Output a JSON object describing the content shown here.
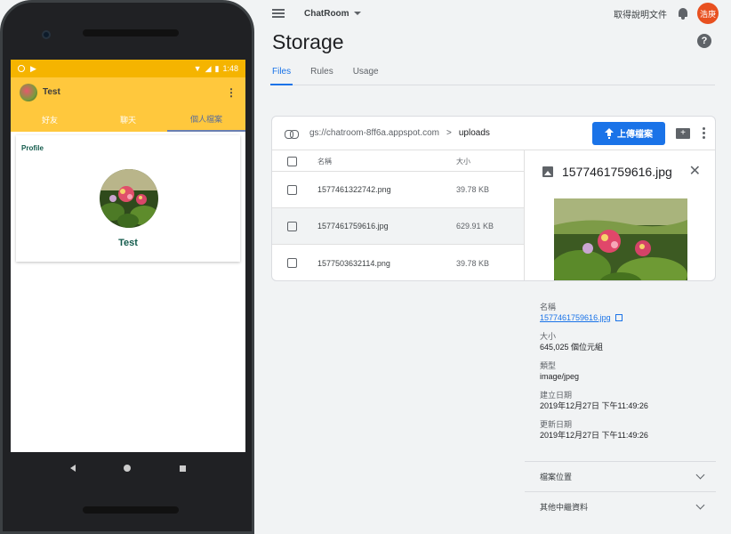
{
  "phone": {
    "status": {
      "time": "1:48"
    },
    "app_bar": {
      "title": "Test"
    },
    "tabs": [
      "好友",
      "聊天",
      "個人檔案"
    ],
    "profile": {
      "section_label": "Profile",
      "name": "Test"
    }
  },
  "console": {
    "project": "ChatRoom",
    "doc_link": "取得說明文件",
    "user_badge": "浩庚",
    "page_title": "Storage",
    "help": "?",
    "tabs": [
      "Files",
      "Rules",
      "Usage"
    ],
    "bucket": "gs://chatroom-8ff6a.appspot.com",
    "crumb_sep": ">",
    "crumb": "uploads",
    "upload_label": "上傳檔案",
    "table": {
      "col_name": "名稱",
      "col_size": "大小",
      "rows": [
        {
          "name": "1577461322742.png",
          "size": "39.78 KB"
        },
        {
          "name": "1577461759616.jpg",
          "size": "629.91 KB"
        },
        {
          "name": "1577503632114.png",
          "size": "39.78 KB"
        }
      ]
    },
    "detail": {
      "title": "1577461759616.jpg",
      "close": "✕",
      "name_label": "名稱",
      "name_value": "1577461759616.jpg",
      "size_label": "大小",
      "size_value": "645,025 個位元組",
      "type_label": "類型",
      "type_value": "image/jpeg",
      "created_label": "建立日期",
      "created_value": "2019年12月27日 下午11:49:26",
      "updated_label": "更新日期",
      "updated_value": "2019年12月27日 下午11:49:26",
      "location_label": "檔案位置",
      "other_meta_label": "其他中繼資料"
    },
    "colors": {
      "accent": "#1a73e8",
      "app_bar": "#ffc83d",
      "status_bar": "#f5b400",
      "badge": "#e8501f"
    }
  }
}
